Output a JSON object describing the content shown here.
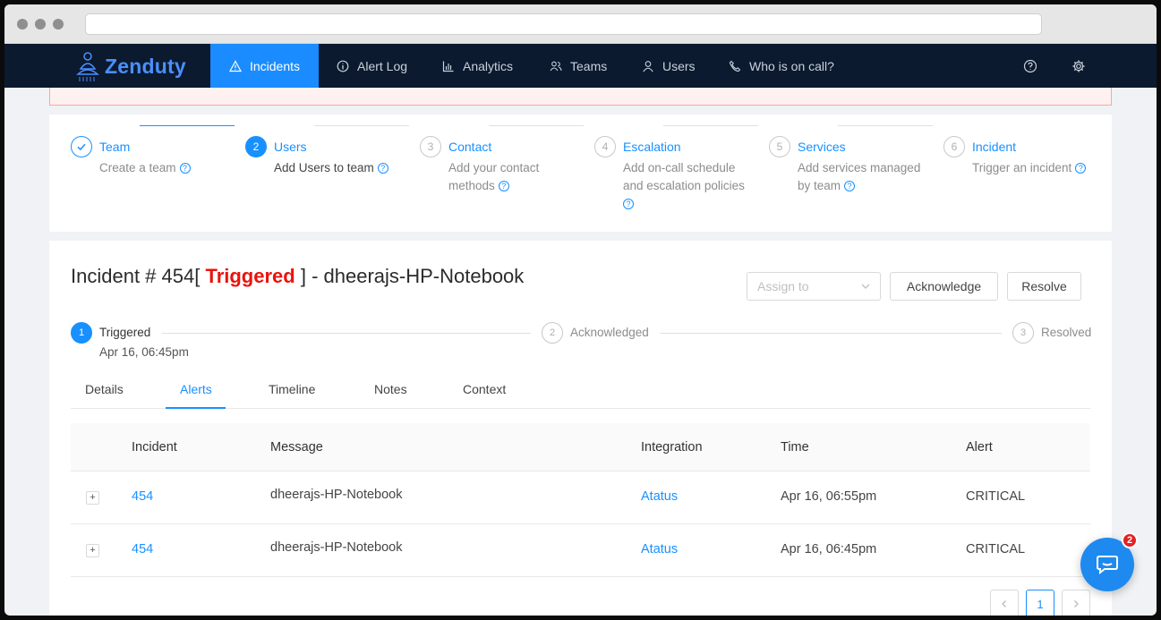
{
  "brand": {
    "name": "Zenduty"
  },
  "nav": {
    "items": [
      {
        "label": "Incidents",
        "icon": "warning-icon",
        "active": true
      },
      {
        "label": "Alert Log",
        "icon": "info-icon",
        "active": false
      },
      {
        "label": "Analytics",
        "icon": "bar-chart-icon",
        "active": false
      },
      {
        "label": "Teams",
        "icon": "team-icon",
        "active": false
      },
      {
        "label": "Users",
        "icon": "user-icon",
        "active": false
      },
      {
        "label": "Who is on call?",
        "icon": "phone-icon",
        "active": false
      }
    ],
    "right_icons": [
      "help-icon",
      "settings-icon"
    ]
  },
  "onboarding": {
    "steps": [
      {
        "number": "1",
        "title": "Team",
        "description": "Create a team",
        "state": "done"
      },
      {
        "number": "2",
        "title": "Users",
        "description": "Add Users to team",
        "state": "current"
      },
      {
        "number": "3",
        "title": "Contact",
        "description": "Add your contact methods",
        "state": "pending"
      },
      {
        "number": "4",
        "title": "Escalation",
        "description": "Add on-call schedule and escalation policies",
        "state": "pending"
      },
      {
        "number": "5",
        "title": "Services",
        "description": "Add services managed by team",
        "state": "pending"
      },
      {
        "number": "6",
        "title": "Incident",
        "description": "Trigger an incident",
        "state": "pending"
      }
    ]
  },
  "incident": {
    "title_prefix": "Incident # 454[",
    "status": "Triggered",
    "title_suffix": "] - dheerajs-HP-Notebook",
    "assign_placeholder": "Assign to",
    "acknowledge_label": "Acknowledge",
    "resolve_label": "Resolve",
    "progress": [
      {
        "number": "1",
        "label": "Triggered",
        "time": "Apr 16, 06:45pm",
        "state": "current"
      },
      {
        "number": "2",
        "label": "Acknowledged",
        "state": "pending"
      },
      {
        "number": "3",
        "label": "Resolved",
        "state": "pending"
      }
    ],
    "tabs": [
      "Details",
      "Alerts",
      "Timeline",
      "Notes",
      "Context"
    ],
    "active_tab": "Alerts"
  },
  "alerts_table": {
    "columns": [
      "Incident",
      "Message",
      "Integration",
      "Time",
      "Alert"
    ],
    "rows": [
      {
        "incident": "454",
        "message": "dheerajs-HP-Notebook",
        "integration": "Atatus",
        "time": "Apr 16, 06:55pm",
        "alert": "CRITICAL"
      },
      {
        "incident": "454",
        "message": "dheerajs-HP-Notebook",
        "integration": "Atatus",
        "time": "Apr 16, 06:45pm",
        "alert": "CRITICAL"
      }
    ]
  },
  "pagination": {
    "current": "1",
    "prev_icon": "chevron-left-icon",
    "next_icon": "chevron-right-icon"
  },
  "chat": {
    "badge": "2"
  },
  "colors": {
    "accent": "#1890ff",
    "nav_bg": "#0b1a2e",
    "triggered": "#e8140d"
  }
}
